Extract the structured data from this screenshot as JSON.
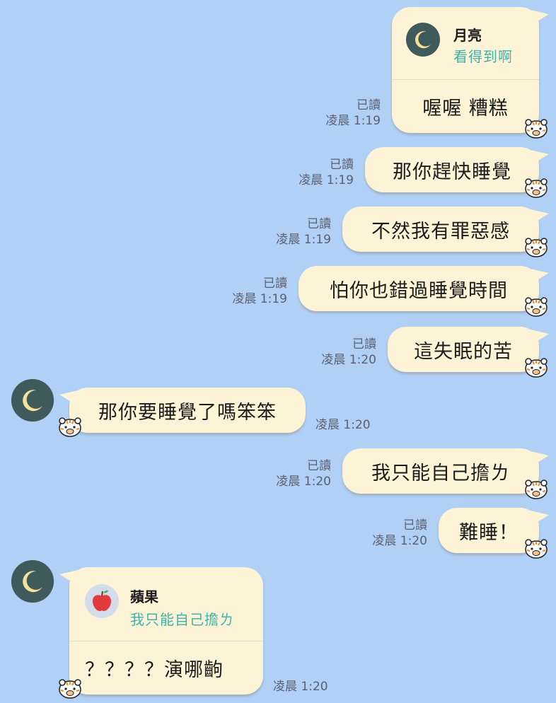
{
  "colors": {
    "background": "#b1d0f6",
    "bubble": "#fdf3d6",
    "reply_teal": "#3eb3a9",
    "avatar": "#3f5a5a",
    "moon": "#f7e09a"
  },
  "messages": [
    {
      "side": "out",
      "reply": {
        "name": "月亮",
        "text": "看得到啊",
        "icon": "moon-icon"
      },
      "text": "喔喔 糟糕",
      "read": "已讀",
      "time": "凌晨 1:19"
    },
    {
      "side": "out",
      "text": "那你趕快睡覺",
      "read": "已讀",
      "time": "凌晨 1:19"
    },
    {
      "side": "out",
      "text": "不然我有罪惡感",
      "read": "已讀",
      "time": "凌晨 1:19"
    },
    {
      "side": "out",
      "text": "怕你也錯過睡覺時間",
      "read": "已讀",
      "time": "凌晨 1:19"
    },
    {
      "side": "out",
      "text": "這失眠的苦",
      "read": "已讀",
      "time": "凌晨 1:20"
    },
    {
      "side": "in",
      "text": "那你要睡覺了嗎笨笨",
      "time": "凌晨 1:20"
    },
    {
      "side": "out",
      "text": "我只能自己擔ㄌ",
      "read": "已讀",
      "time": "凌晨 1:20"
    },
    {
      "side": "out",
      "text": "難睡！",
      "read": "已讀",
      "time": "凌晨 1:20"
    },
    {
      "side": "in",
      "reply": {
        "name": "蘋果",
        "text": "我只能自己擔ㄌ",
        "icon": "apple-icon"
      },
      "text": "？？？？演哪齣",
      "time": "凌晨 1:20"
    }
  ]
}
